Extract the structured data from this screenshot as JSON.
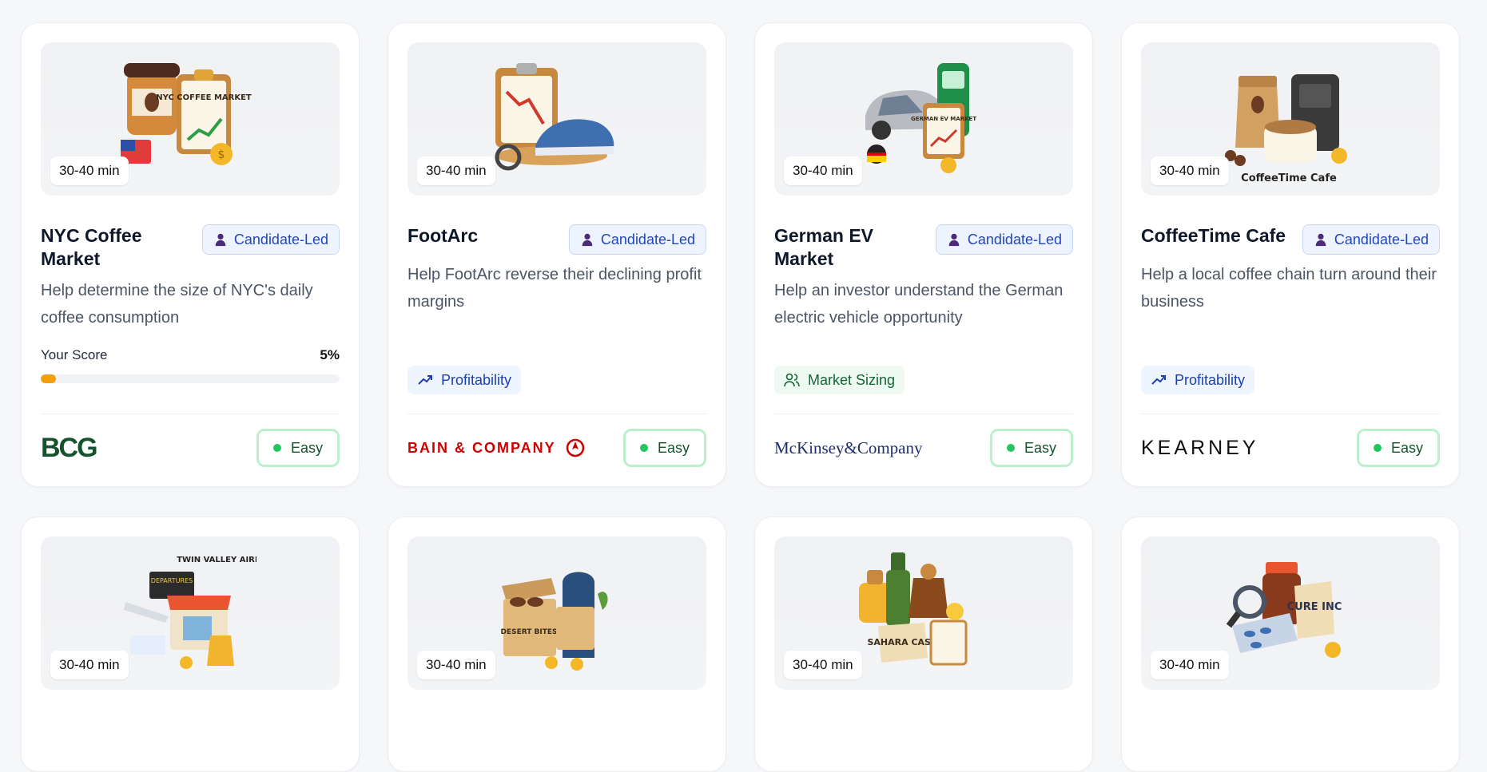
{
  "cards": [
    {
      "duration": "30-40 min",
      "title": "NYC Coffee Market",
      "mode": "Candidate-Led",
      "description": "Help determine the size of NYC's daily coffee consumption",
      "score_label": "Your Score",
      "score_text": "5%",
      "score_value": 0.05,
      "difficulty": "Easy",
      "company": "BCG",
      "image_caption": "NYC COFFEE MARKET",
      "image_icon": "coffee-cup-clipboard-icon"
    },
    {
      "duration": "30-40 min",
      "title": "FootArc",
      "mode": "Candidate-Led",
      "description": "Help FootArc reverse their declining profit margins",
      "category": "Profitability",
      "category_color": "#1e40af",
      "difficulty": "Easy",
      "company": "BAIN & COMPANY",
      "image_icon": "clipboard-sneaker-icon"
    },
    {
      "duration": "30-40 min",
      "title": "German EV Market",
      "mode": "Candidate-Led",
      "description": "Help an investor understand the German electric vehicle opportunity",
      "category": "Market Sizing",
      "category_color": "#166534",
      "difficulty": "Easy",
      "company": "McKinsey&Company",
      "image_caption": "GERMAN EV MARKET",
      "image_icon": "car-charger-icon"
    },
    {
      "duration": "30-40 min",
      "title": "CoffeeTime Cafe",
      "mode": "Candidate-Led",
      "description": "Help a local coffee chain turn around their business",
      "category": "Profitability",
      "category_color": "#1e40af",
      "difficulty": "Easy",
      "company": "KEARNEY",
      "image_caption": "CoffeeTime Cafe",
      "image_icon": "coffee-bag-cup-icon"
    },
    {
      "duration": "30-40 min",
      "image_caption": "TWIN VALLEY AIRPORT",
      "image_sign": "DEPARTURES",
      "image_icon": "airport-shop-icon"
    },
    {
      "duration": "30-40 min",
      "image_caption": "DESERT BITES",
      "image_icon": "dates-box-icon"
    },
    {
      "duration": "30-40 min",
      "image_caption": "SAHARA CASE",
      "image_icon": "perfume-oil-icon"
    },
    {
      "duration": "30-40 min",
      "image_caption": "CURE INC",
      "image_icon": "medicine-bottle-icon"
    }
  ],
  "colors": {
    "accent_blue": "#2446b5",
    "easy_green": "#22c55e",
    "score_orange": "#f59e0b"
  }
}
